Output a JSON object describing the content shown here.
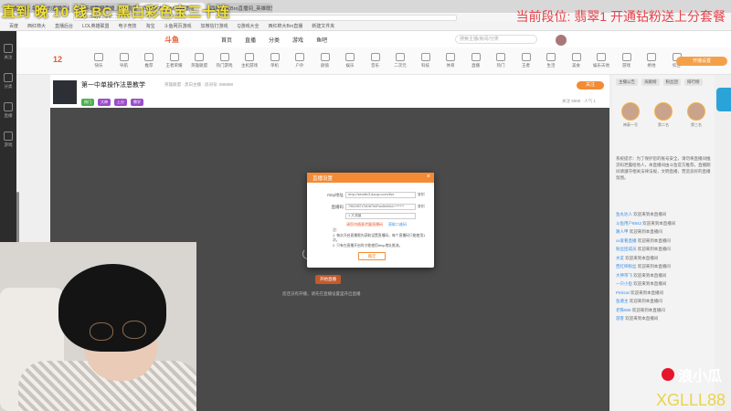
{
  "browser": {
    "tabs": [
      {
        "label": "斗鱼直播 - 每个人的直播平台"
      },
      {
        "label": "LOL英雄联盟直播_LOL视频"
      },
      {
        "label": "西红柿大BGM的直播间"
      },
      {
        "label": "西红柿大Bro直播间_英雄联盟"
      }
    ],
    "url": "www.douyu.com/...",
    "bookmarks": [
      "百度",
      "西红柿大",
      "直播后台",
      "LOL英雄联盟",
      "电子竞技",
      "淘宝",
      "斗鱼网页游戏",
      "加微信打游戏",
      "Q游戏大全",
      "西红柿大Bro直播",
      "新建文件夹"
    ]
  },
  "overlay": {
    "top_left": "直到 晚 10 钱 BC 黑白彩色宝三十连",
    "top_right": "当前段位: 翡翠1  开通钻粉送上分套餐",
    "brand": "浪小瓜",
    "brand_icon": "weibo-icon",
    "streamer_id": "XGLLL88"
  },
  "sidebar": {
    "items": [
      {
        "label": "关注",
        "icon": "heart-icon"
      },
      {
        "label": "分类",
        "icon": "grid-icon"
      },
      {
        "label": "直播",
        "icon": "tv-icon"
      },
      {
        "label": "游戏",
        "icon": "gamepad-icon"
      }
    ]
  },
  "site": {
    "logo": "斗鱼",
    "nav": [
      "首页",
      "直播",
      "分类",
      "游戏",
      "鱼吧"
    ],
    "search_placeholder": "搜索主播/房间/分类"
  },
  "categories": {
    "date": "12",
    "items": [
      "快乐",
      "导航",
      "推荐",
      "王者荣耀",
      "英雄联盟",
      "热门游戏",
      "主机游戏",
      "单机",
      "户外",
      "颜值",
      "娱乐",
      "音乐",
      "二次元",
      "科技",
      "体育",
      "直播",
      "热门",
      "王者",
      "生活",
      "美食",
      "娱乐天地",
      "游戏",
      "绝地",
      "综合"
    ],
    "right_button": "开播设置"
  },
  "room": {
    "title": "第一中单操作法恩教学",
    "subtitle": "英雄联盟 · 黑白主播 · 房间号: 888888",
    "tags": [
      "热门",
      "大神",
      "上分",
      "教学"
    ],
    "follow": "关注",
    "stats": "关注 8888 · 人气 1"
  },
  "player": {
    "prompt": "您还没有开播，请先在直播设置里开启直播",
    "button": "开始直播"
  },
  "right_panel": {
    "tabs": [
      "主播公告",
      "贡献榜",
      "粉丝团",
      "排行榜"
    ],
    "ranking": [
      "神豪一号",
      "第二名",
      "第三名"
    ],
    "notice": "系统提示：为了保护您的账号安全，请勿将直播间推流码泄露给他人，本直播间由斗鱼官方推荐。直播期间请遵守相关法律法规，文明直播，营造良好的直播氛围。",
    "chat": [
      {
        "user": "鱼丸达人",
        "text": "欢迎来到本直播间"
      },
      {
        "user": "斗鱼用户8842",
        "text": "欢迎来到本直播间"
      },
      {
        "user": "路人甲",
        "text": "欢迎来到本直播间"
      },
      {
        "user": "xx爱看直播",
        "text": "欢迎来到本直播间"
      },
      {
        "user": "粉丝团成员",
        "text": "欢迎来到本直播间"
      },
      {
        "user": "水友",
        "text": "欢迎来到本直播间"
      },
      {
        "user": "西红柿粉丝",
        "text": "欢迎来到本直播间"
      },
      {
        "user": "大神带飞",
        "text": "欢迎来到本直播间"
      },
      {
        "user": "一只小鱼",
        "text": "欢迎来到本直播间"
      },
      {
        "user": "Pinkcat",
        "text": "欢迎来到本直播间"
      },
      {
        "user": "鱼塘主",
        "text": "欢迎来到本直播间"
      },
      {
        "user": "老铁666",
        "text": "欢迎来到本直播间"
      },
      {
        "user": "游客",
        "text": "欢迎来到本直播间"
      }
    ]
  },
  "dialog": {
    "title": "直播设置",
    "rtmp_label": "rtmp地址",
    "rtmp_value": "rtmp://sendtc3.douyu.com/live",
    "rtmp_copy": "复制",
    "code_label": "直播码",
    "code_value": "7981957r7kD87hkFsu6le46d=*******",
    "code_copy": "复制",
    "select_value": "1 大流量",
    "warning": "请您勿随意泄露直播码",
    "warning_link": "获取二维码",
    "notes": "注：\n1. 每次开启直播需先获取设置直播码，每个直播码只能使用1次。\n2. 只有在直播开启时才能使用rtmp地址推流。",
    "confirm": "确定"
  }
}
